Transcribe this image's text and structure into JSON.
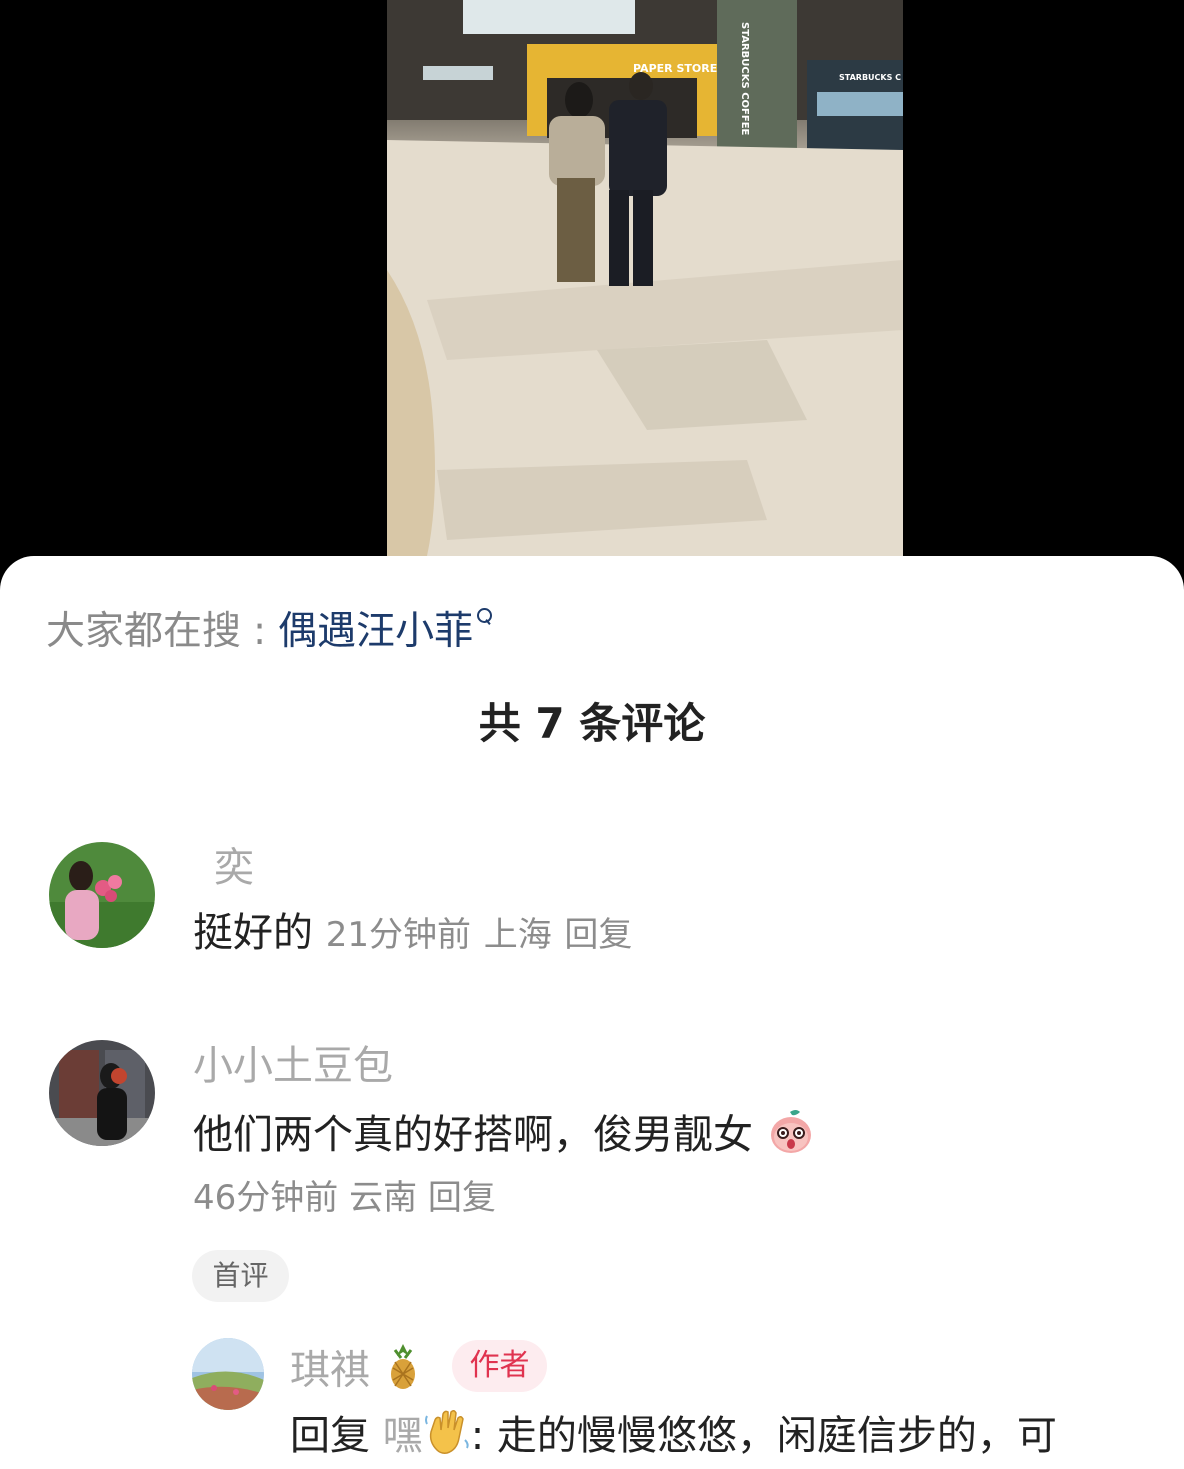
{
  "search": {
    "prefix": "大家都在搜",
    "separator": ":",
    "term": "偶遇汪小菲"
  },
  "comments_header": {
    "count_text": "共 7 条评论"
  },
  "comments": [
    {
      "username": "奕",
      "text": "挺好的",
      "time": "21分钟前",
      "location": "上海",
      "reply_label": "回复"
    },
    {
      "username": "小小土豆包",
      "text": "他们两个真的好搭啊，俊男靓女",
      "emoji": "surprised-peach-emoji",
      "time": "46分钟前",
      "location": "云南",
      "reply_label": "回复",
      "tag": "首评",
      "replies": [
        {
          "username": "琪祺",
          "username_emoji": "pineapple-emoji",
          "badge": "作者",
          "reply_prefix": "回复",
          "mention": "嘿",
          "mention_emoji": "waving-hand-emoji",
          "text": ": 走的慢慢悠悠，闲庭信步的，可"
        }
      ]
    }
  ],
  "colors": {
    "search_term": "#1d3b6b",
    "author_badge_text": "#e0334f",
    "author_badge_bg": "#fdecef",
    "meta_text": "#8c8c8c",
    "username_text": "#a9a9a9"
  },
  "photo": {
    "signs": [
      "PAPER STORE",
      "STARBUCKS COFFEE",
      "STARBUCKS C"
    ]
  }
}
